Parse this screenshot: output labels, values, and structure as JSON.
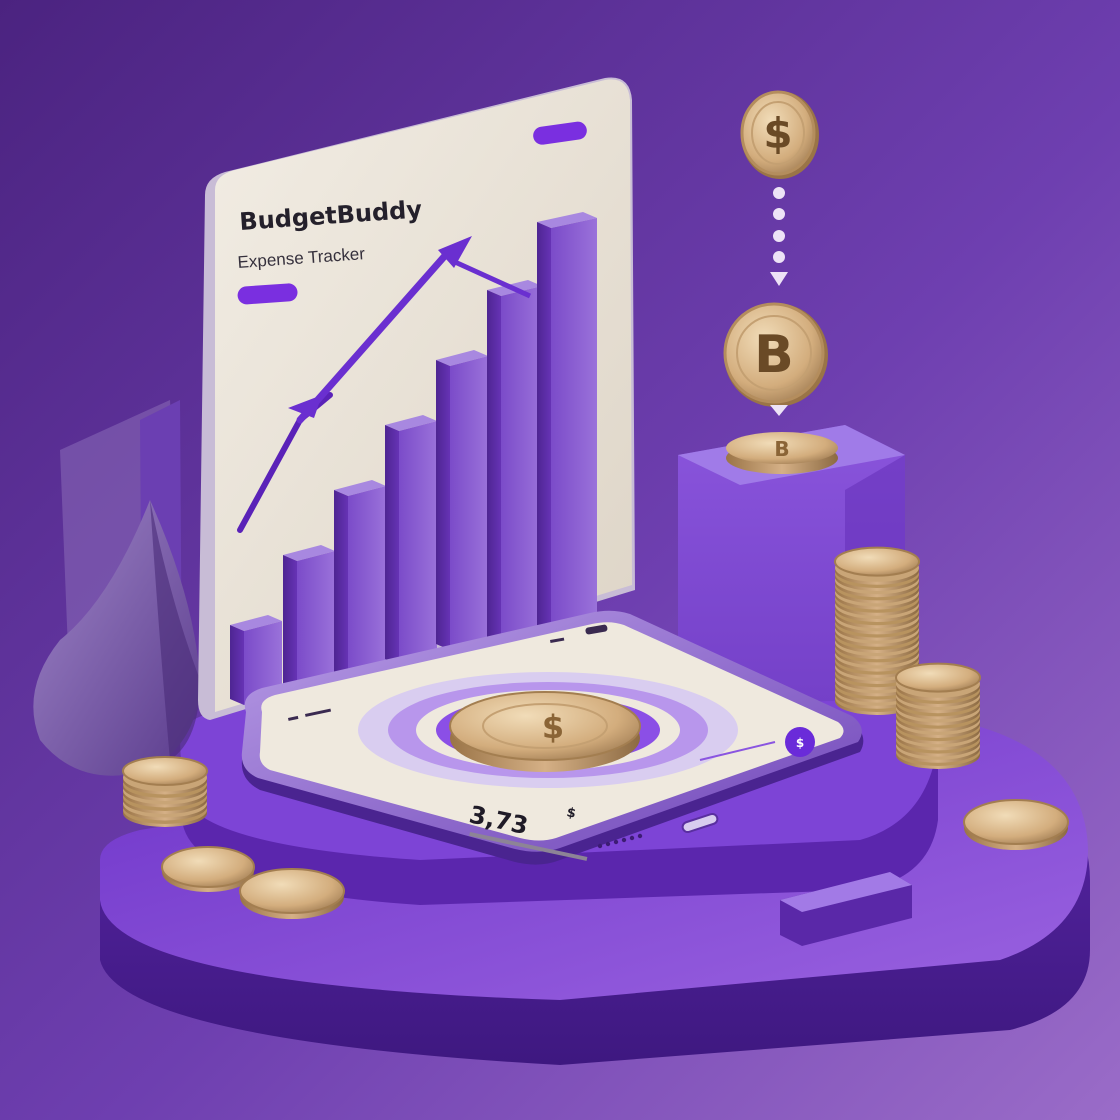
{
  "board": {
    "title": "BudgetBuddy",
    "subtitle": "Expense Tracker"
  },
  "phone": {
    "amount": "3,73",
    "amount_suffix": "$"
  },
  "icons": {
    "dollar_coin": "dollar-coin-icon",
    "bitcoin_coin": "bitcoin-coin-icon",
    "dollar_glyph": "$",
    "bitcoin_glyph": "B"
  },
  "colors": {
    "background_light": "#8f5fc0",
    "background_dark": "#4e2682",
    "platform": "#7a3fd0",
    "board": "#ece6dc",
    "coin_gold": "#d7b588",
    "accent": "#6a2bd9"
  }
}
